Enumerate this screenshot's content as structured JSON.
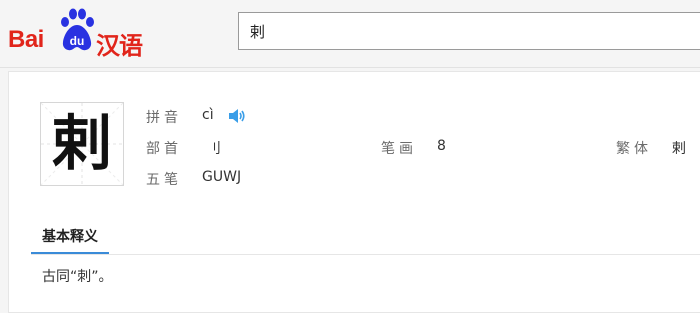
{
  "header": {
    "logo": {
      "latin": "Bai",
      "du": "du",
      "chinese": "汉语"
    },
    "search": {
      "value": "剌",
      "placeholder": ""
    }
  },
  "character": {
    "glyph": "剌",
    "pinyin": {
      "label": "拼音",
      "value": "cì"
    },
    "radical": {
      "label": "部首",
      "value": "刂"
    },
    "strokes": {
      "label": "笔画",
      "value": "8"
    },
    "traditional": {
      "label": "繁体",
      "value": "剌"
    },
    "wubi": {
      "label": "五笔",
      "value": "GUWJ"
    }
  },
  "tabs": [
    {
      "label": "基本释义"
    }
  ],
  "definition": "古同“刺”。",
  "icons": {
    "pronounce": "speaker-icon"
  },
  "colors": {
    "brand_red": "#e1251b",
    "brand_blue": "#2932e1",
    "tab_underline": "#3a8bd8",
    "speaker": "#3a9ee8"
  }
}
